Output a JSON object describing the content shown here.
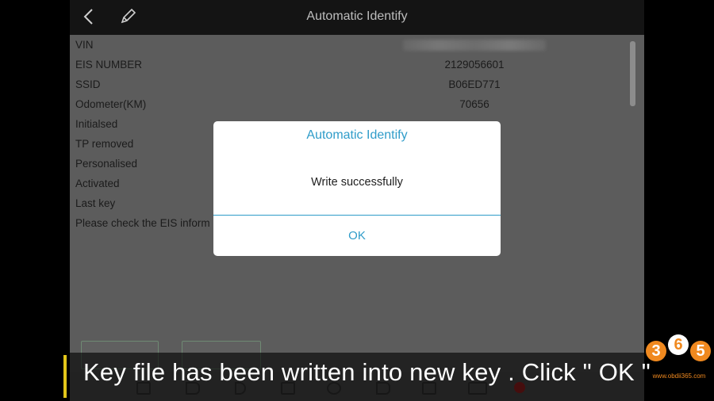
{
  "header": {
    "title": "Automatic Identify"
  },
  "rows": [
    {
      "label": "VIN",
      "value": ""
    },
    {
      "label": "EIS NUMBER",
      "value": "2129056601"
    },
    {
      "label": "SSID",
      "value": "B06ED771"
    },
    {
      "label": "Odometer(KM)",
      "value": "70656"
    },
    {
      "label": "Initialsed",
      "value": ""
    },
    {
      "label": "TP removed",
      "value": ""
    },
    {
      "label": "Personalised",
      "value": ""
    },
    {
      "label": "Activated",
      "value": ""
    },
    {
      "label": "Last key",
      "value": ""
    },
    {
      "label": "Please check the EIS inform",
      "value": ""
    }
  ],
  "dialog": {
    "title": "Automatic Identify",
    "message": "Write successfully",
    "ok_label": "OK"
  },
  "subtitle": "Key file has been written into new key . Click \" OK \"",
  "logo": {
    "digits": [
      "3",
      "6",
      "5"
    ],
    "site": "www.obdii365.com"
  },
  "colors": {
    "accent": "#2f9cc9",
    "subtitle_accent": "#e3c61a",
    "logo": "#f0891f"
  }
}
